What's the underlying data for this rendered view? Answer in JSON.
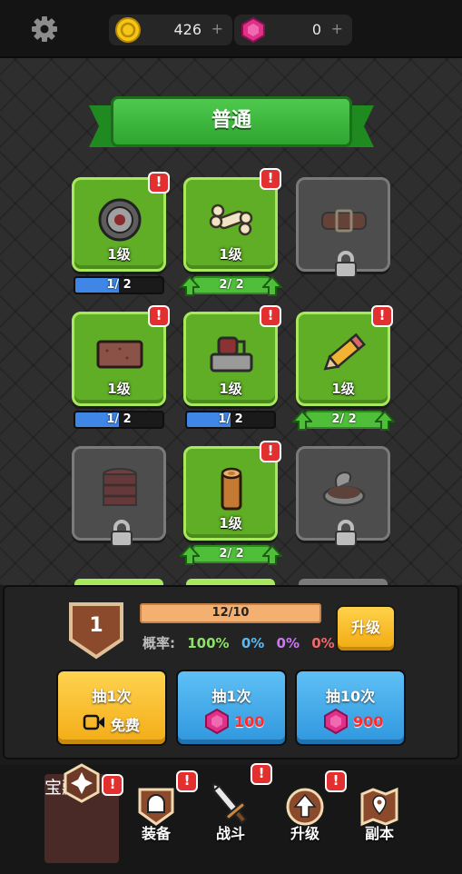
{
  "currency": {
    "coins": "426",
    "gems": "0",
    "plus": "+"
  },
  "banner": {
    "title": "普通"
  },
  "items": [
    {
      "level": "1级",
      "progress": "1/ 2",
      "fill": 0.5,
      "state": "active",
      "art": "target-icon",
      "alert": "!"
    },
    {
      "level": "1级",
      "progress": "2/ 2",
      "fill": 1.0,
      "state": "upgradable",
      "art": "bone-icon",
      "alert": "!"
    },
    {
      "level": "",
      "progress": "",
      "state": "locked",
      "art": "belt-icon"
    },
    {
      "level": "1级",
      "progress": "1/ 2",
      "fill": 0.5,
      "state": "active",
      "art": "brick-icon",
      "alert": "!"
    },
    {
      "level": "1级",
      "progress": "1/ 2",
      "fill": 0.5,
      "state": "active",
      "art": "tape-dispenser-icon",
      "alert": "!"
    },
    {
      "level": "1级",
      "progress": "2/ 2",
      "fill": 1.0,
      "state": "upgradable",
      "art": "pencil-icon",
      "alert": "!"
    },
    {
      "level": "",
      "progress": "",
      "state": "locked",
      "art": "barrel-icon"
    },
    {
      "level": "1级",
      "progress": "2/ 2",
      "fill": 1.0,
      "state": "upgradable",
      "art": "wood-log-icon",
      "alert": "!"
    },
    {
      "level": "",
      "progress": "",
      "state": "locked",
      "art": "pot-icon"
    }
  ],
  "level_panel": {
    "level": "1",
    "xp_text": "12/10",
    "rates_label": "概率:",
    "rates": [
      {
        "value": "100%",
        "color": "#8ee06a"
      },
      {
        "value": "0%",
        "color": "#5cb8f0"
      },
      {
        "value": "0%",
        "color": "#c878f0"
      },
      {
        "value": "0%",
        "color": "#f06868"
      }
    ],
    "upgrade_label": "升级"
  },
  "draws": [
    {
      "title": "抽1次",
      "sub": "免费",
      "style": "yellow",
      "icon": "video-icon"
    },
    {
      "title": "抽1次",
      "sub": "100",
      "style": "blue",
      "icon": "gem-icon"
    },
    {
      "title": "抽10次",
      "sub": "900",
      "style": "blue",
      "icon": "gem-icon"
    }
  ],
  "nav": [
    {
      "label": "宝藏",
      "icon": "treasure-icon",
      "selected": true,
      "alert": "!"
    },
    {
      "label": "装备",
      "icon": "helmet-icon",
      "alert": "!"
    },
    {
      "label": "战斗",
      "icon": "sword-icon",
      "alert": "!"
    },
    {
      "label": "升级",
      "icon": "upgrade-arrow-icon",
      "alert": "!"
    },
    {
      "label": "副本",
      "icon": "map-icon"
    }
  ],
  "colors": {
    "accent_green": "#5fae26",
    "gem": "#e0308a",
    "coin": "#f5c518",
    "alert": "#e23030"
  }
}
